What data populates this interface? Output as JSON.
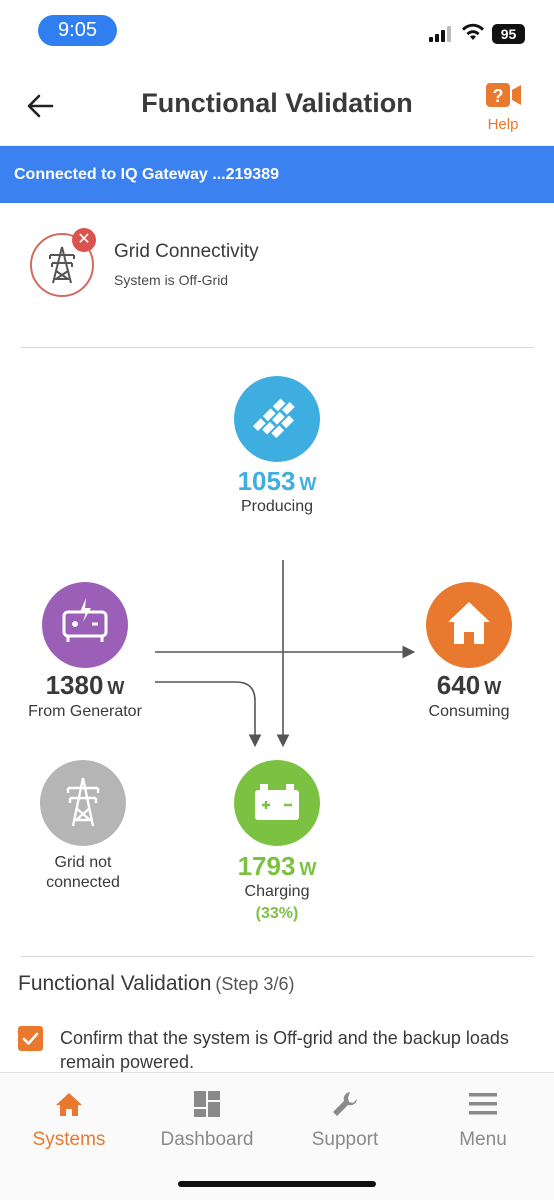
{
  "status_bar": {
    "time": "9:05",
    "battery": "95"
  },
  "nav": {
    "title": "Functional Validation",
    "help_label": "Help"
  },
  "banner": {
    "text": "Connected to IQ Gateway ...219389"
  },
  "grid_connectivity": {
    "title": "Grid Connectivity",
    "status": "System is Off-Grid"
  },
  "flow": {
    "producing": {
      "value": "1053",
      "unit": "W",
      "label": "Producing",
      "color": "#3eaee0"
    },
    "generator": {
      "value": "1380",
      "unit": "W",
      "label": "From Generator",
      "color": "#9b5fb8"
    },
    "consuming": {
      "value": "640",
      "unit": "W",
      "label": "Consuming",
      "color": "#e8792e"
    },
    "grid": {
      "label": "Grid not connected",
      "color": "#b5b5b5"
    },
    "charging": {
      "value": "1793",
      "unit": "W",
      "label": "Charging",
      "percent": "(33%)",
      "color": "#7cc242"
    }
  },
  "functional_validation": {
    "heading": "Functional Validation",
    "step": "(Step 3/6)",
    "checklist": [
      {
        "text": "Confirm that the system is Off-grid and the backup loads remain powered.",
        "checked": true
      }
    ]
  },
  "tabs": [
    {
      "label": "Systems",
      "icon": "home-icon",
      "active": true
    },
    {
      "label": "Dashboard",
      "icon": "dashboard-icon",
      "active": false
    },
    {
      "label": "Support",
      "icon": "wrench-icon",
      "active": false
    },
    {
      "label": "Menu",
      "icon": "menu-icon",
      "active": false
    }
  ],
  "colors": {
    "accent": "#e8792e",
    "banner": "#3b82f0",
    "error": "#d9534f"
  }
}
